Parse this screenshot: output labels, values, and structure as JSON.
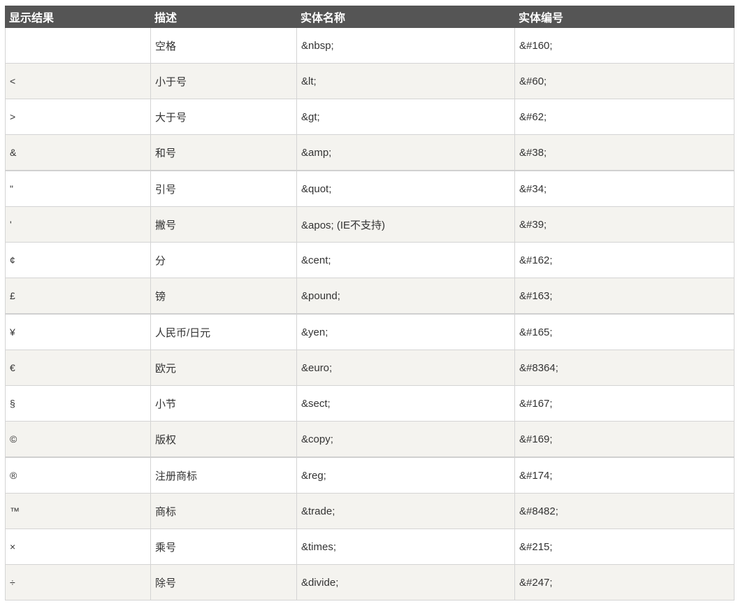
{
  "table": {
    "headers": [
      "显示结果",
      "描述",
      "实体名称",
      "实体编号"
    ],
    "rows": [
      {
        "result": " ",
        "description": "空格",
        "entity_name": "&nbsp;",
        "entity_number": "&#160;"
      },
      {
        "result": "<",
        "description": "小于号",
        "entity_name": "&lt;",
        "entity_number": "&#60;"
      },
      {
        "result": ">",
        "description": "大于号",
        "entity_name": "&gt;",
        "entity_number": "&#62;"
      },
      {
        "result": "&",
        "description": "和号",
        "entity_name": "&amp;",
        "entity_number": "&#38;"
      },
      {
        "result": "\"",
        "description": "引号",
        "entity_name": "&quot;",
        "entity_number": "&#34;"
      },
      {
        "result": "'",
        "description": "撇号",
        "entity_name": "&apos; (IE不支持)",
        "entity_number": "&#39;"
      },
      {
        "result": "¢",
        "description": "分",
        "entity_name": "&cent;",
        "entity_number": "&#162;"
      },
      {
        "result": "£",
        "description": "镑",
        "entity_name": "&pound;",
        "entity_number": "&#163;"
      },
      {
        "result": "¥",
        "description": "人民币/日元",
        "entity_name": "&yen;",
        "entity_number": "&#165;"
      },
      {
        "result": "€",
        "description": "欧元",
        "entity_name": "&euro;",
        "entity_number": "&#8364;"
      },
      {
        "result": "§",
        "description": "小节",
        "entity_name": "&sect;",
        "entity_number": "&#167;"
      },
      {
        "result": "©",
        "description": "版权",
        "entity_name": "&copy;",
        "entity_number": "&#169;"
      },
      {
        "result": "®",
        "description": "注册商标",
        "entity_name": "&reg;",
        "entity_number": "&#174;"
      },
      {
        "result": "™",
        "description": "商标",
        "entity_name": "&trade;",
        "entity_number": "&#8482;"
      },
      {
        "result": "×",
        "description": "乘号",
        "entity_name": "&times;",
        "entity_number": "&#215;"
      },
      {
        "result": "÷",
        "description": "除号",
        "entity_name": "&divide;",
        "entity_number": "&#247;"
      }
    ]
  }
}
